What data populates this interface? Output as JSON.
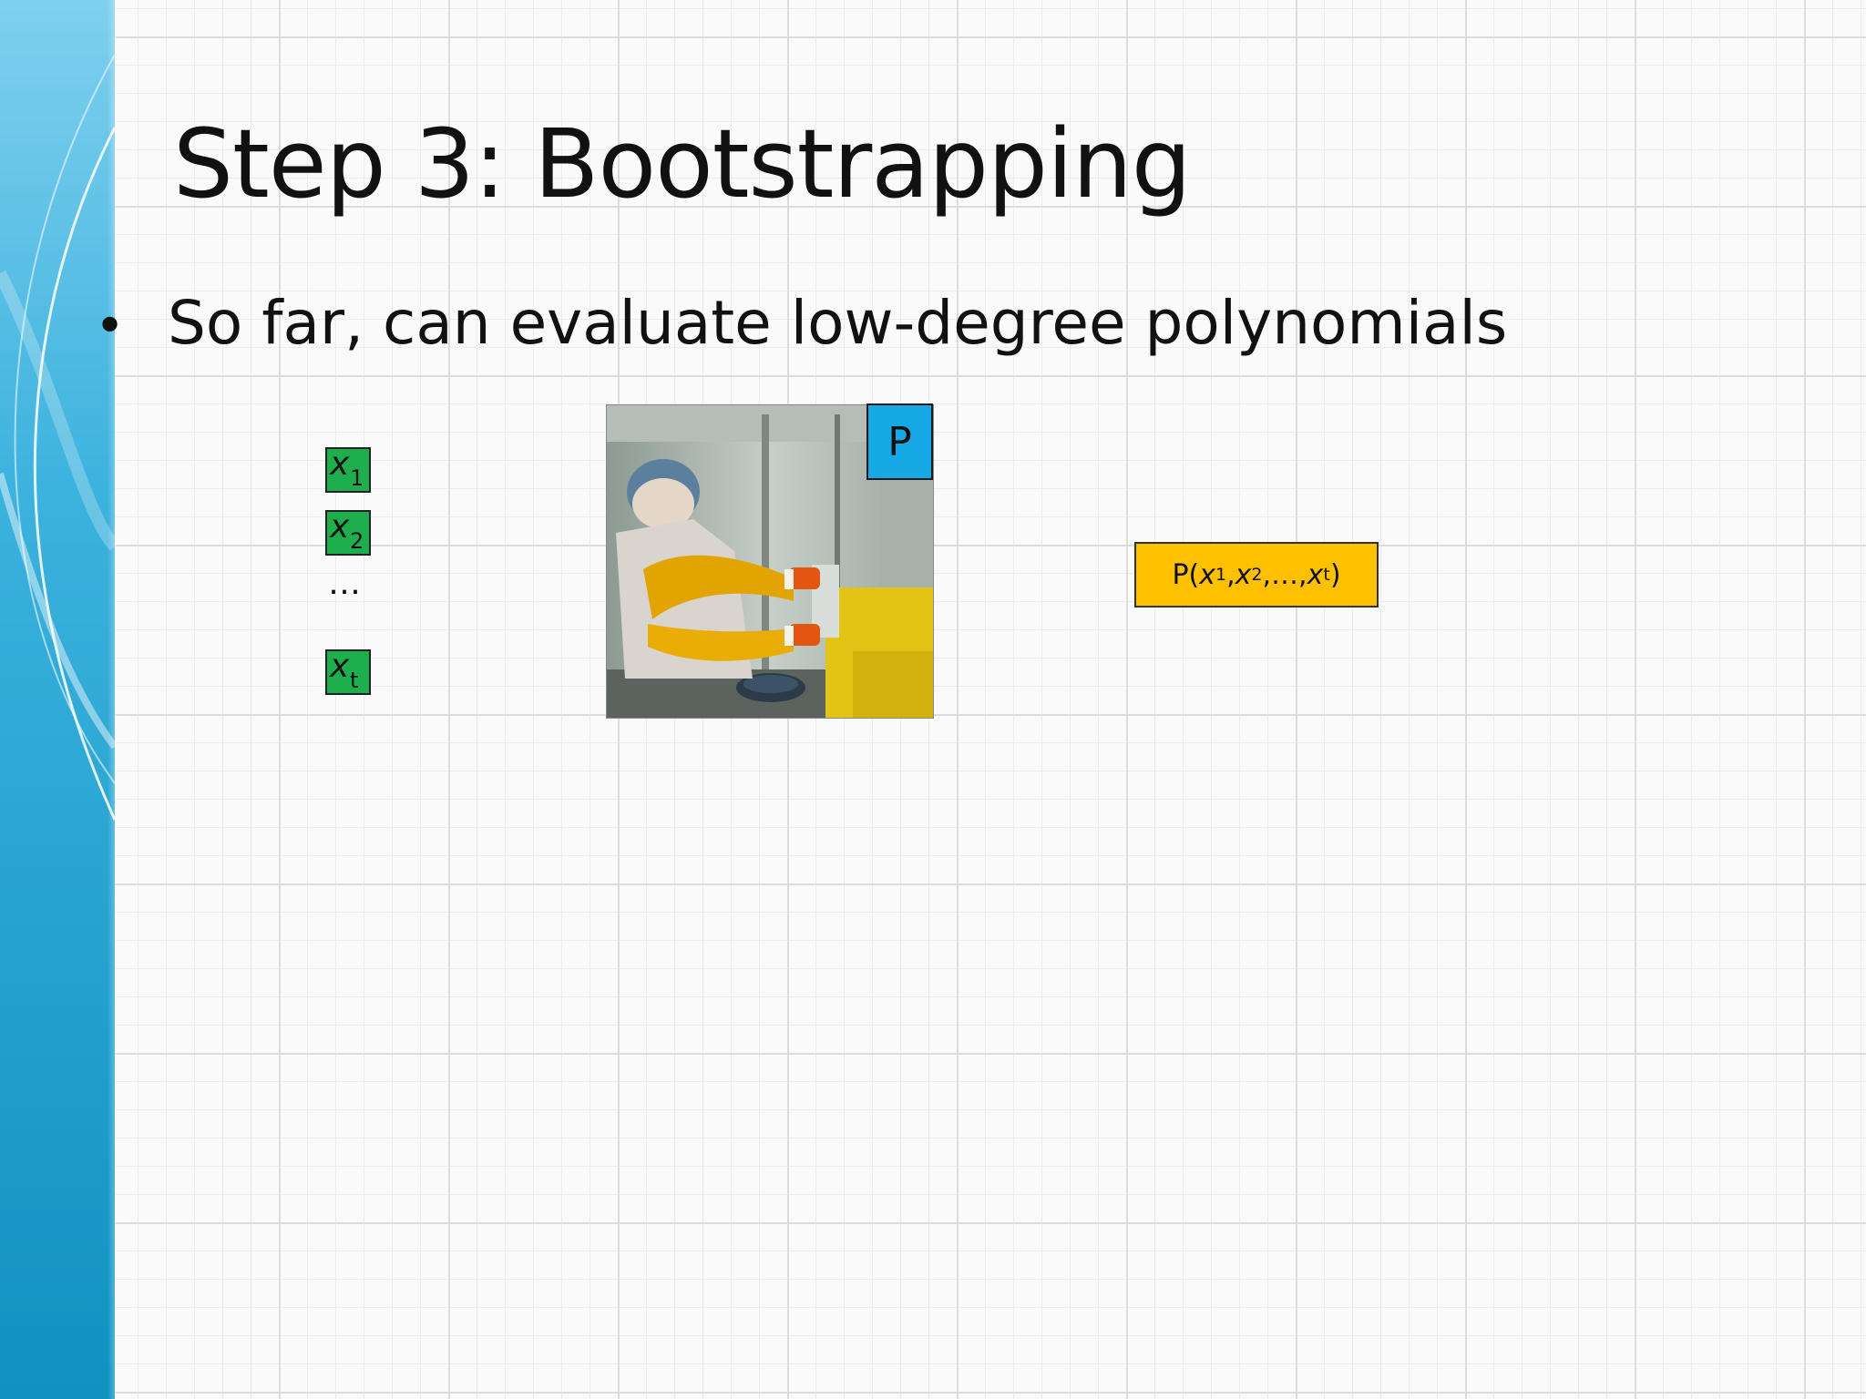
{
  "slide": {
    "title": "Step 3: Bootstrapping",
    "bullet": "So far, can evaluate low-degree polynomials"
  },
  "inputs": [
    {
      "var": "x",
      "sub": "1"
    },
    {
      "var": "x",
      "sub": "2"
    },
    {
      "var": "x",
      "sub": "t"
    }
  ],
  "ellipsis": "…",
  "program_label": "P",
  "output": {
    "func": "P(",
    "args": [
      {
        "var": "x",
        "sub": "1",
        "sep": ", "
      },
      {
        "var": "x",
        "sub": "2",
        "sep": " ,…, "
      },
      {
        "var": "x",
        "sub": "t",
        "sep": ")"
      }
    ]
  },
  "colors": {
    "input_box": "#1eae4e",
    "program_box": "#17a8e6",
    "output_box": "#ffc000",
    "band_blue": "#1494c4"
  }
}
